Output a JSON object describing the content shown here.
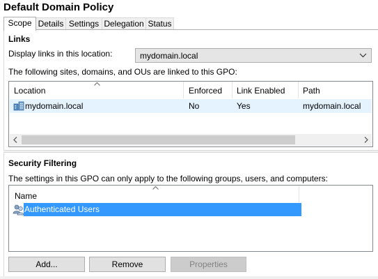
{
  "window": {
    "title": "Default Domain Policy"
  },
  "tabs": [
    {
      "label": "Scope",
      "active": true
    },
    {
      "label": "Details",
      "active": false
    },
    {
      "label": "Settings",
      "active": false
    },
    {
      "label": "Delegation",
      "active": false
    },
    {
      "label": "Status",
      "active": false
    }
  ],
  "links": {
    "section_title": "Links",
    "display_label": "Display links in this location:",
    "location_value": "mydomain.local",
    "description": "The following sites, domains, and OUs are linked to this GPO:",
    "columns": [
      "Location",
      "Enforced",
      "Link Enabled",
      "Path"
    ],
    "rows": [
      {
        "location": "mydomain.local",
        "enforced": "No",
        "link_enabled": "Yes",
        "path": "mydomain.local",
        "icon": "domain-icon"
      }
    ]
  },
  "security_filtering": {
    "section_title": "Security Filtering",
    "description": "The settings in this GPO can only apply to the following groups, users, and computers:",
    "columns": [
      "Name"
    ],
    "rows": [
      {
        "name": "Authenticated Users",
        "icon": "users-icon",
        "selected": true
      }
    ],
    "buttons": {
      "add": "Add...",
      "remove": "Remove",
      "properties": "Properties"
    }
  },
  "colors": {
    "selection": "#3399ff",
    "hover_row": "#e5f3ff",
    "accent_border": "#adadad"
  }
}
